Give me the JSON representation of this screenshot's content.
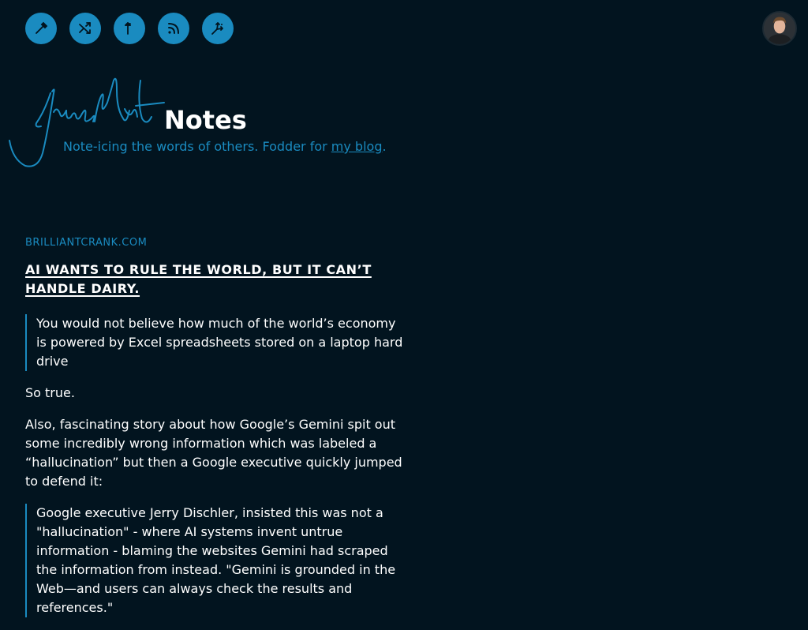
{
  "toolbar": {
    "icons": [
      "eyedropper-icon",
      "shuffle-icon",
      "arrow-up-icon",
      "rss-icon",
      "fork-icon"
    ]
  },
  "header": {
    "title": "Notes",
    "tagline_prefix": "Note-icing the words of others. Fodder for ",
    "tagline_link": "my blog",
    "tagline_suffix": "."
  },
  "post": {
    "source": "BRILLIANTCRANK.COM",
    "title": "AI WANTS TO RULE THE WORLD, BUT IT CAN’T HANDLE DAIRY.",
    "quote1": "You would not believe how much of the world’s economy is powered by Excel spreadsheets stored on a laptop hard drive",
    "para1": "So true.",
    "para2": "Also, fascinating story about how Google’s Gemini spit out some incredibly wrong information which was labeled a “hallucination” but then a Google executive quickly jumped to defend it:",
    "quote2": "Google executive Jerry Dischler, insisted this was not a \"hallucination\" - where AI systems invent untrue information - blaming the websites Gemini had scraped the information from instead. \"Gemini is grounded in the Web—and users can always check the results and references.\""
  },
  "colors": {
    "background": "#02141f",
    "accent": "#1a8bc0",
    "text": "#ffffff"
  }
}
